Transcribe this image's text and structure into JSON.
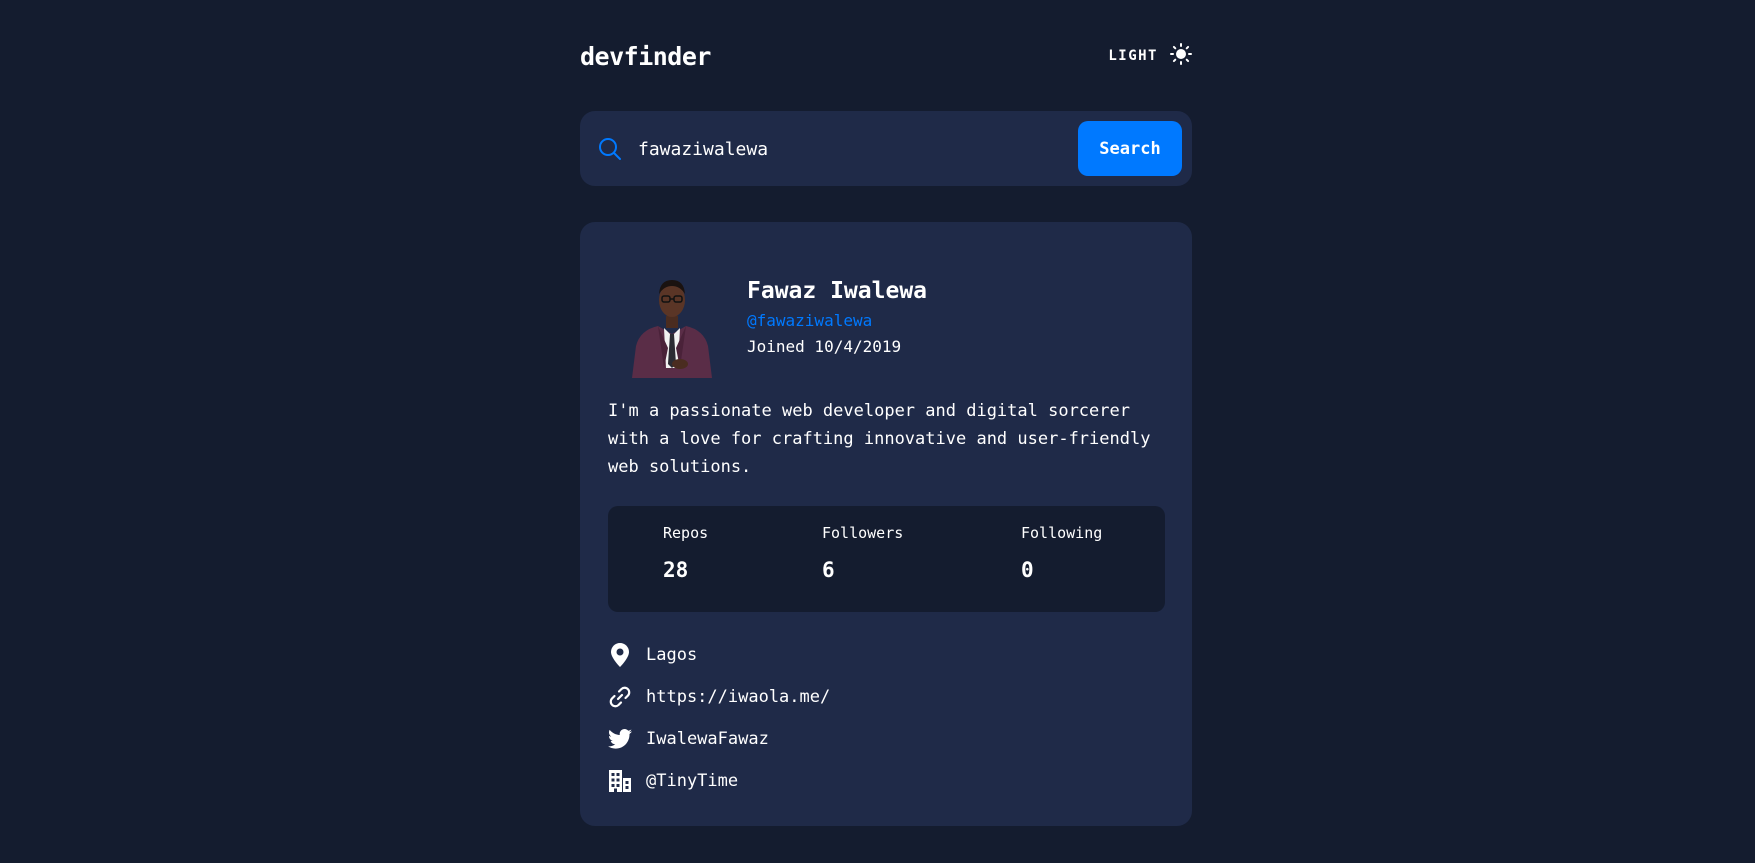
{
  "header": {
    "logo": "devfinder",
    "theme_label": "LIGHT",
    "theme_icon": "sun-icon"
  },
  "search": {
    "value": "fawaziwalewa",
    "button_label": "Search",
    "icon": "search-icon"
  },
  "profile": {
    "name": "Fawaz Iwalewa",
    "login": "@fawaziwalewa",
    "joined": "Joined 10/4/2019",
    "bio": "I'm a passionate web developer and digital sorcerer with a love for crafting innovative and user-friendly web solutions.",
    "stats": [
      {
        "label": "Repos",
        "value": "28"
      },
      {
        "label": "Followers",
        "value": "6"
      },
      {
        "label": "Following",
        "value": "0"
      }
    ],
    "links": [
      {
        "icon": "location-pin-icon",
        "text": "Lagos"
      },
      {
        "icon": "link-icon",
        "text": "https://iwaola.me/"
      },
      {
        "icon": "twitter-icon",
        "text": "IwalewaFawaz"
      },
      {
        "icon": "building-icon",
        "text": "@TinyTime"
      }
    ]
  },
  "colors": {
    "background": "#141c2f",
    "card": "#1f2a48",
    "accent": "#0079ff",
    "text": "#ffffff"
  }
}
